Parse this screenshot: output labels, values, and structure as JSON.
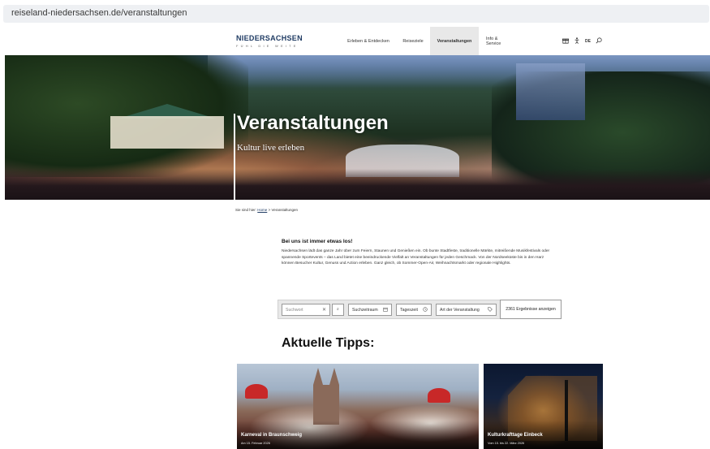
{
  "browser": {
    "url": "reiseland-niedersachsen.de/veranstaltungen"
  },
  "header": {
    "logo_main": "NIEDERSACHSEN",
    "logo_tagline": "FÜHL DIE WEITE",
    "nav": [
      {
        "label": "Erleben & Entdecken"
      },
      {
        "label": "Reiseziele"
      },
      {
        "label": "Veranstaltungen",
        "active": true
      },
      {
        "label": "Info & Service"
      }
    ],
    "icons": [
      "gift-icon",
      "accessibility-icon",
      "search-icon"
    ],
    "language": "DE"
  },
  "hero": {
    "title": "Veranstaltungen",
    "subtitle": "Kultur live erleben"
  },
  "breadcrumb": {
    "prefix": "Sie sind hier:",
    "home": "Home",
    "separator": ">",
    "current": "Veranstaltungen"
  },
  "intro": {
    "title": "Bei uns ist immer etwas los!",
    "text": "Niedersachsen lädt das ganze Jahr über zum Feiern, Staunen und Genießen ein. Ob bunte Stadtfeste, traditionelle Märkte, mitreißende Musikfestivals oder spannende Sportevents – das Land bietet eine beeindruckende Vielfalt an Veranstaltungen für jeden Geschmack. Von der Nordseeküste bis in den Harz können Besucher Kultur, Genuss und Action erleben. Ganz gleich, ob Sommer-Open-Air, Weihnachtsmarkt oder regionale Highlights."
  },
  "search": {
    "keyword_placeholder": "Suchwort",
    "clear_symbol": "✕",
    "search_symbol": "⌕",
    "period_label": "Suchzeitraum",
    "daytime_label": "Tageszeit",
    "type_label": "Art der Veranstaltung",
    "results_label": "2361 Ergebnisse anzeigen"
  },
  "tips": {
    "heading": "Aktuelle Tipps:",
    "cards": [
      {
        "title": "Karneval in Braunschweig",
        "date": "Am 15. Februar 2026"
      },
      {
        "title": "Kulturkrafttage Einbeck",
        "date": "Vom 15. bis 22. März 2026"
      }
    ]
  },
  "colors": {
    "brand": "#1f3b63",
    "active_nav_bg": "#e8e8e8",
    "search_bar_bg": "#e8e8e8"
  }
}
